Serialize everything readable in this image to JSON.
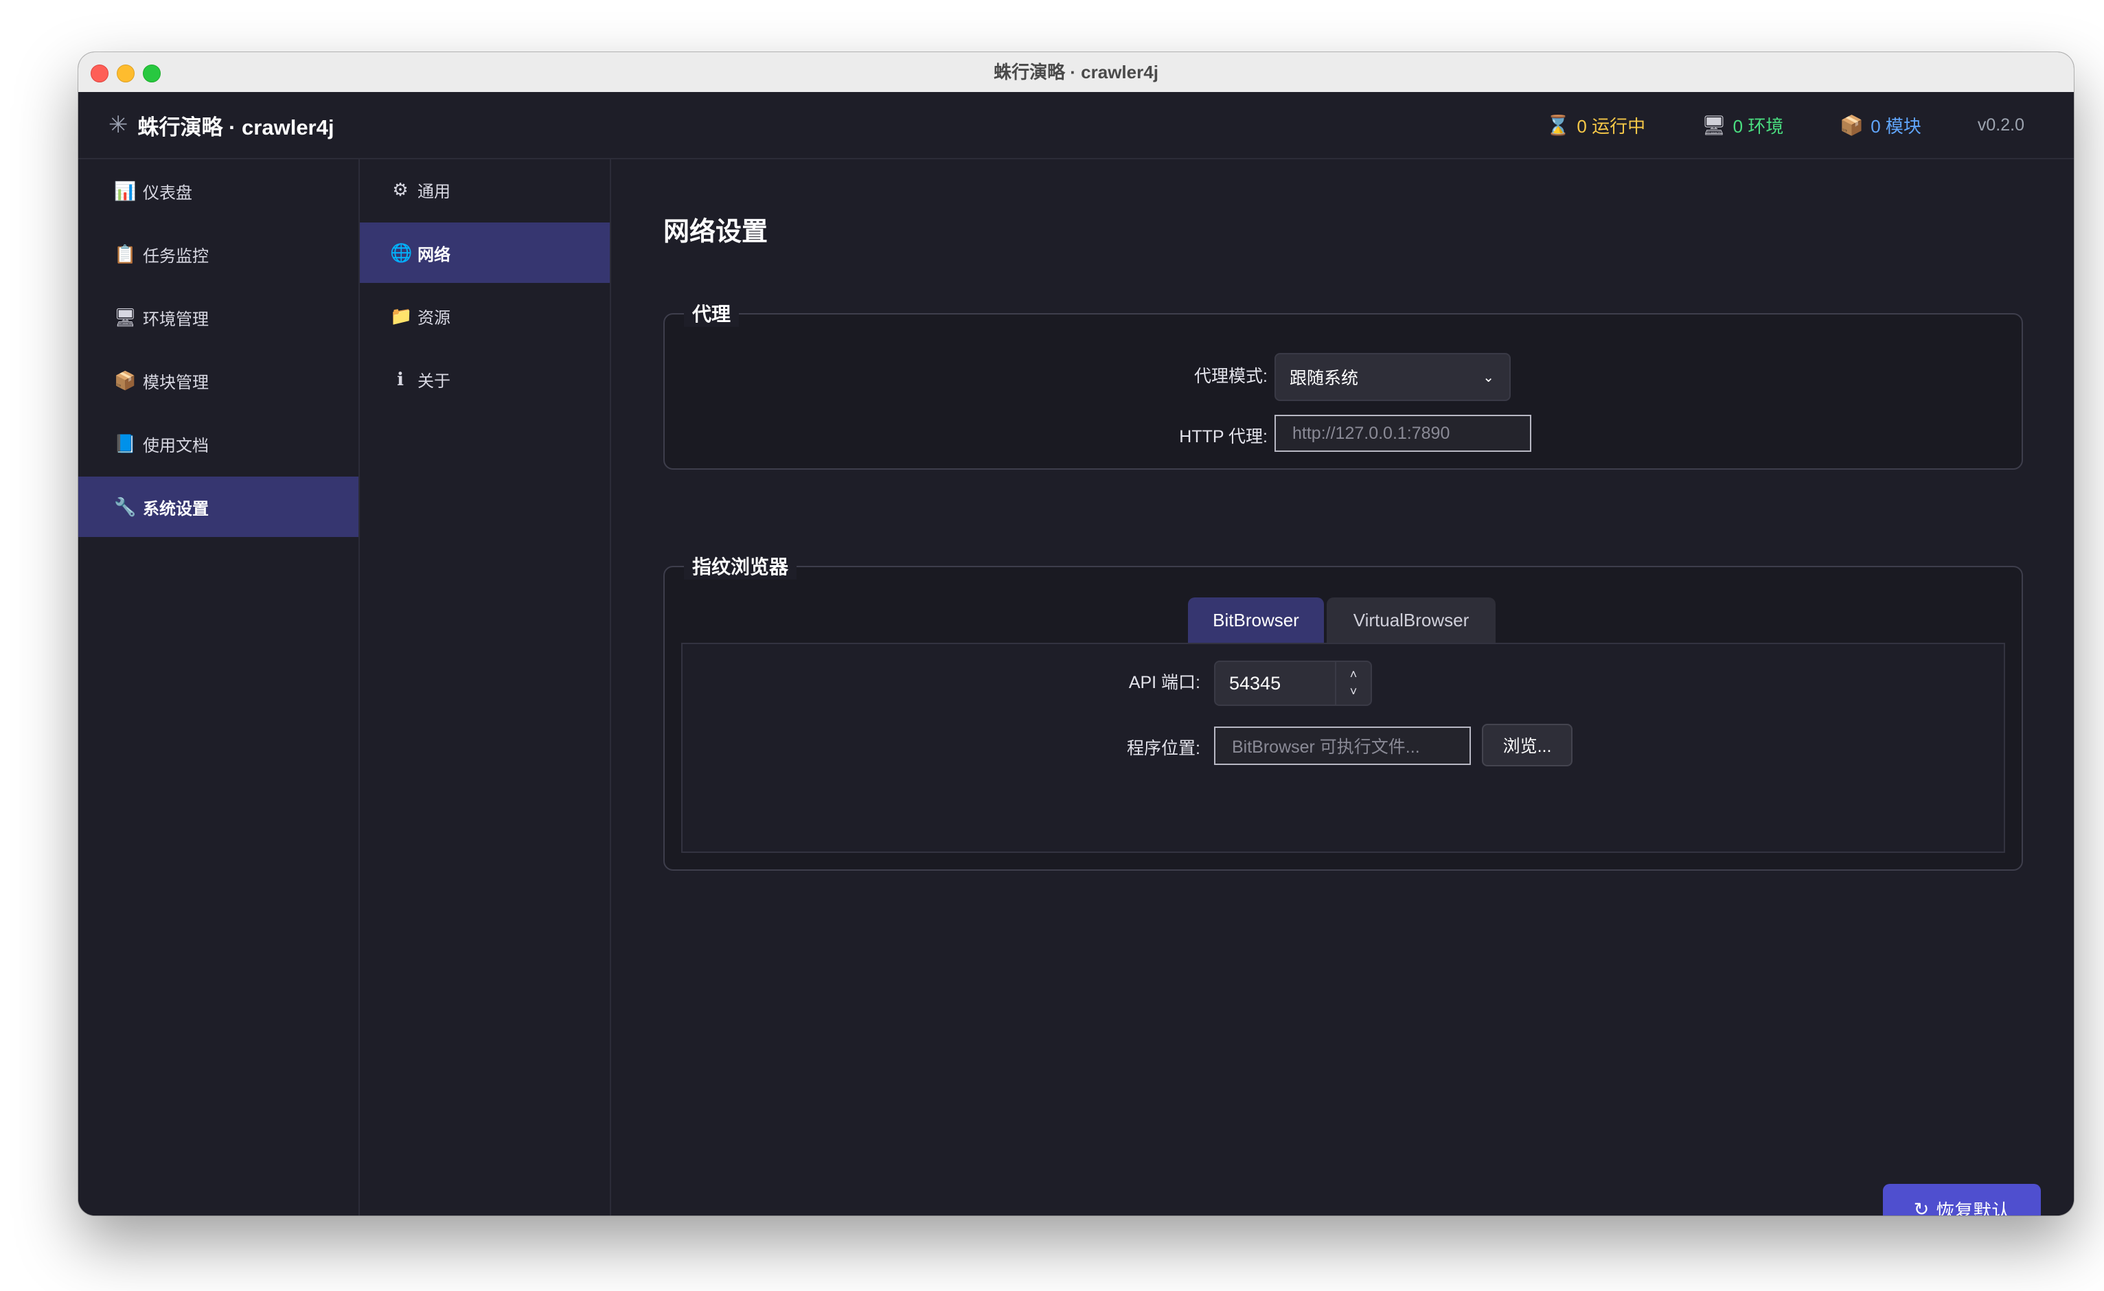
{
  "window": {
    "title": "蛛行演略 · crawler4j"
  },
  "header": {
    "logo_icon": "spider-icon",
    "brand": "蛛行演略 · crawler4j",
    "running": {
      "icon": "hourglass-icon",
      "label": "0 运行中",
      "color": "#f7c948"
    },
    "envs": {
      "icon": "monitor-icon",
      "label": "0 环境",
      "color": "#4ade80"
    },
    "modules": {
      "icon": "package-icon",
      "label": "0 模块",
      "color": "#60a5fa"
    },
    "version": "v0.2.0"
  },
  "sidebar": {
    "items": [
      {
        "icon": "chart-icon",
        "label": "仪表盘"
      },
      {
        "icon": "clipboard-icon",
        "label": "任务监控"
      },
      {
        "icon": "monitor-icon",
        "label": "环境管理"
      },
      {
        "icon": "package-icon",
        "label": "模块管理"
      },
      {
        "icon": "book-icon",
        "label": "使用文档"
      },
      {
        "icon": "wrench-icon",
        "label": "系统设置",
        "active": true
      }
    ]
  },
  "subnav": {
    "items": [
      {
        "icon": "gear-icon",
        "label": "通用"
      },
      {
        "icon": "globe-icon",
        "label": "网络",
        "active": true
      },
      {
        "icon": "folder-icon",
        "label": "资源"
      },
      {
        "icon": "info-icon",
        "label": "关于"
      }
    ]
  },
  "main": {
    "title": "网络设置",
    "proxy": {
      "title": "代理",
      "mode_label": "代理模式:",
      "mode_value": "跟随系统",
      "http_label": "HTTP 代理:",
      "http_placeholder": "http://127.0.0.1:7890"
    },
    "browser": {
      "title": "指纹浏览器",
      "tabs": [
        {
          "label": "BitBrowser",
          "active": true
        },
        {
          "label": "VirtualBrowser",
          "active": false
        }
      ],
      "api_port_label": "API 端口:",
      "api_port_value": "54345",
      "path_label": "程序位置:",
      "path_placeholder": "BitBrowser 可执行文件...",
      "browse_label": "浏览..."
    },
    "reset_icon": "refresh-icon",
    "reset_label": "恢复默认"
  },
  "colors": {
    "accent": "#4f4fcf",
    "active_nav": "#363670",
    "background": "#1e1e28"
  }
}
